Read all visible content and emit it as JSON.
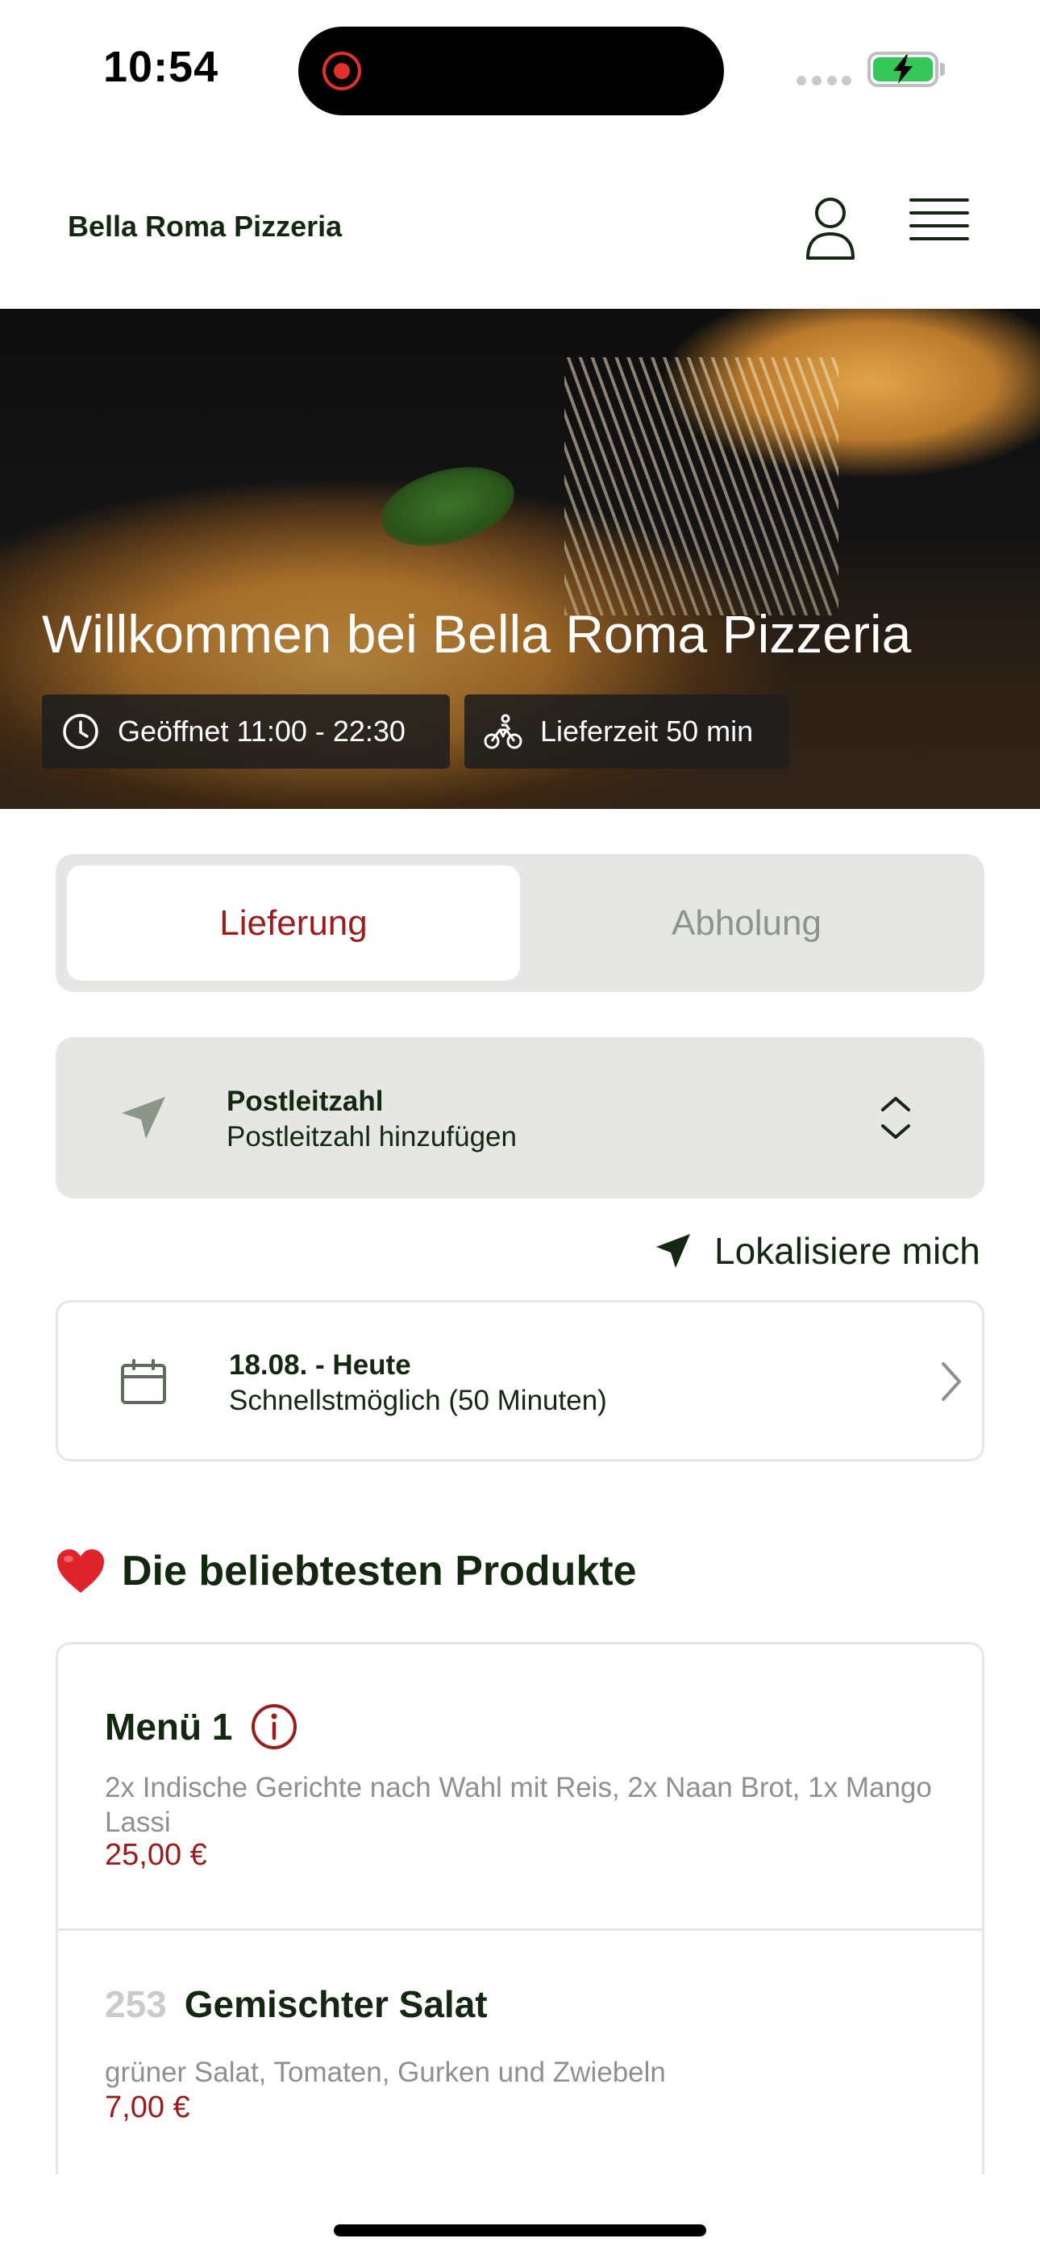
{
  "status_bar": {
    "time": "10:54"
  },
  "header": {
    "brand": "Bella Roma Pizzeria",
    "icons": [
      "user-icon",
      "hamburger-menu-icon"
    ]
  },
  "hero": {
    "title": "Willkommen bei Bella Roma Pizzeria",
    "opening_hours": "Geöffnet 11:00 - 22:30",
    "delivery_time": "Lieferzeit 50 min"
  },
  "order_mode": {
    "options": [
      "Lieferung",
      "Abholung"
    ],
    "selected": "Lieferung"
  },
  "zip": {
    "label": "Postleitzahl",
    "value": "Postleitzahl hinzufügen"
  },
  "locate": {
    "label": "Lokalisiere mich"
  },
  "date": {
    "title": "18.08. - Heute",
    "subtitle": "Schnellstmöglich (50 Minuten)"
  },
  "popular": {
    "heading": "Die beliebtesten Produkte",
    "products": [
      {
        "number": "",
        "name": "Menü 1",
        "description": "2x Indische Gerichte nach Wahl mit Reis, 2x Naan Brot, 1x Mango Lassi",
        "price": "25,00 €"
      },
      {
        "number": "253",
        "name": "Gemischter Salat",
        "description": "grüner Salat, Tomaten, Gurken und Zwiebeln",
        "price": "7,00 €"
      }
    ]
  },
  "colors": {
    "brand_dark": "#13290f",
    "accent_red": "#9b1c1c",
    "muted_gray": "#8a9688",
    "field_bg": "#e6e7e4"
  }
}
